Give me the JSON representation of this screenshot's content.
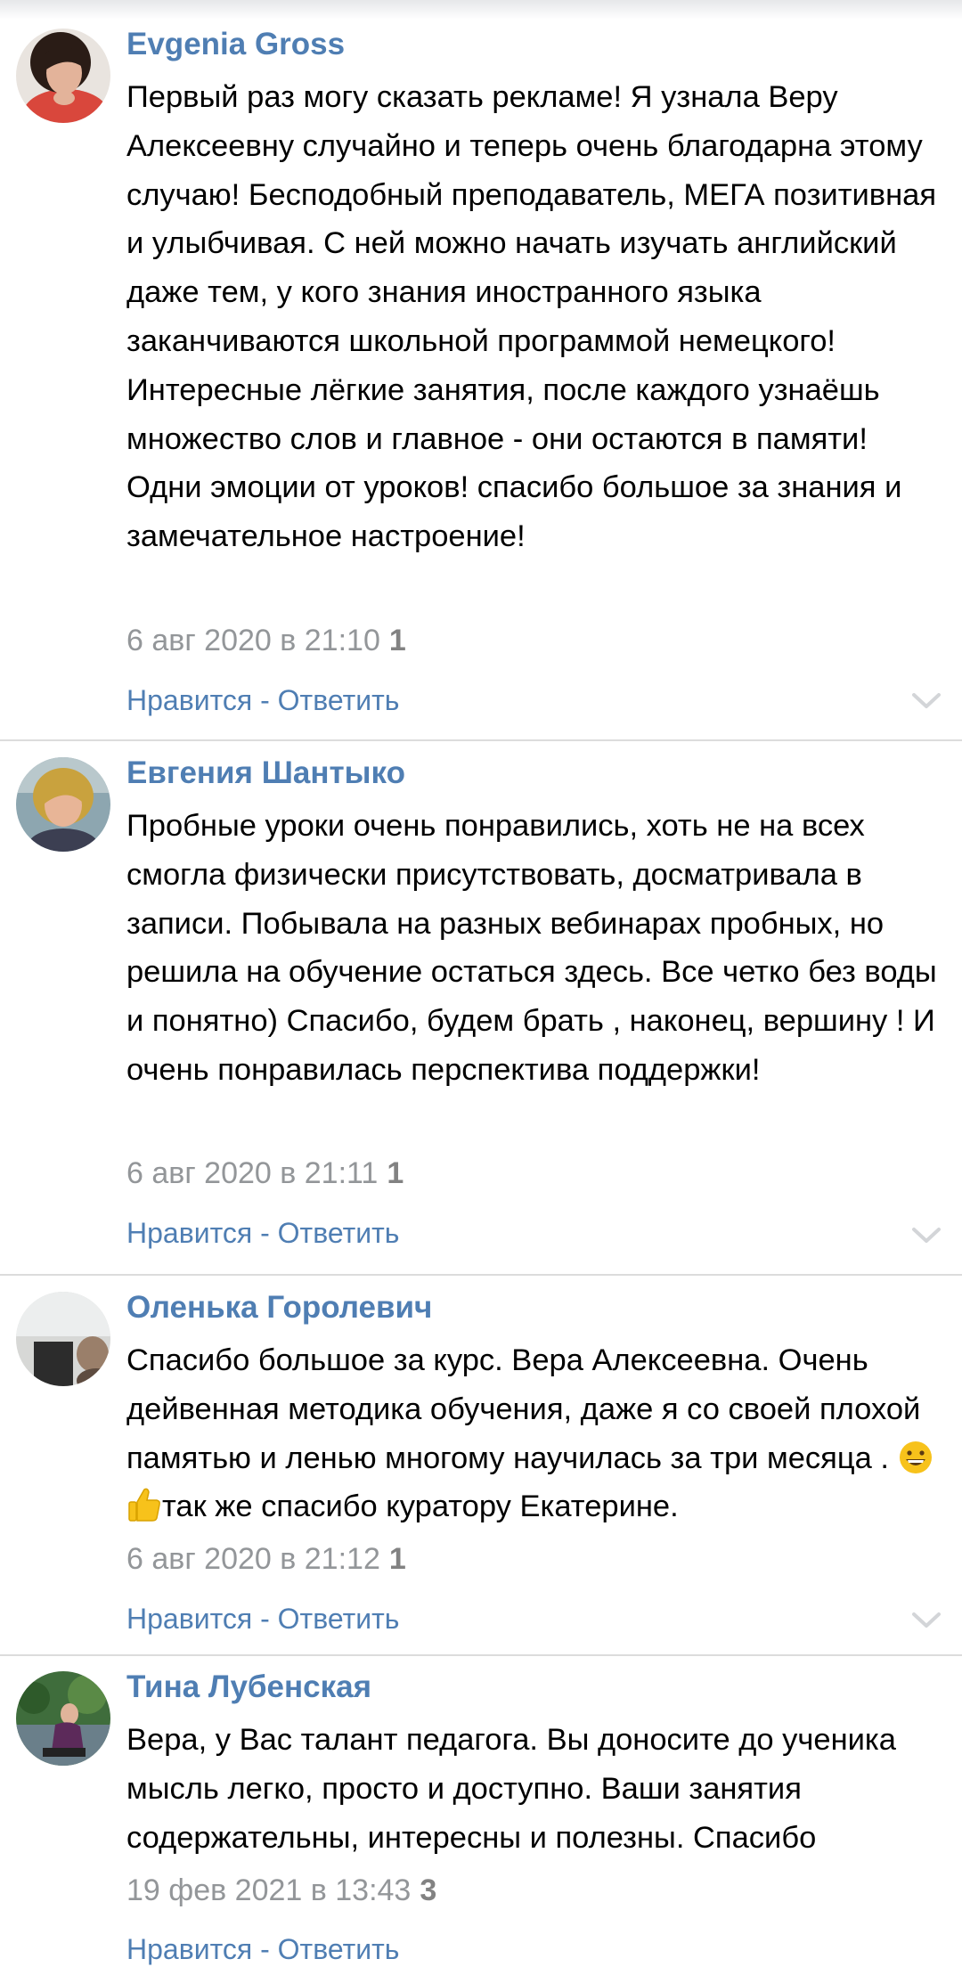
{
  "comments": [
    {
      "author": "Evgenia Gross",
      "paragraphs": [
        "Первый раз могу сказать рекламе! Я узнала Веру Алексеевну случайно и теперь очень благодарна этому случаю! Бесподобный преподаватель, МЕГА позитивная и улыбчивая. С ней можно начать изучать английский даже тем, у кого знания иностранного языка заканчиваются школьной программой немецкого!",
        "Интересные лёгкие занятия, после каждого узнаёшь множество слов и главное - они остаются в памяти! Одни эмоции от уроков! спасибо большое за знания и замечательное настроение!"
      ],
      "date": "6 авг 2020 в 21:10",
      "likes": "1",
      "like_label": "Нравится",
      "separator": " - ",
      "reply_label": "Ответить"
    },
    {
      "author": "Евгения Шантыко",
      "paragraphs": [
        "Пробные уроки очень понравились, хоть не на всех смогла физически присутствовать, досматривала в записи. Побывала на разных вебинарах пробных, но решила на обучение остаться здесь. Все четко без воды и понятно) Спасибо, будем брать , наконец, вершину ! И очень понравилась перспектива поддержки!"
      ],
      "date": "6 авг 2020 в 21:11",
      "likes": "1",
      "like_label": "Нравится",
      "separator": " - ",
      "reply_label": "Ответить"
    },
    {
      "author": "Оленька Горолевич",
      "text_before_emoji": "Спасибо большое за курс. Вера Алексеевна. Очень дейвенная методика обучения, даже я со своей плохой памятью и ленью многому научилась за три месяца . ",
      "text_after_emoji": "так же спасибо куратору Екатерине.",
      "emoji": [
        "grinning-face-emoji",
        "thumbs-up-emoji"
      ],
      "date": "6 авг 2020 в 21:12",
      "likes": "1",
      "like_label": "Нравится",
      "separator": " - ",
      "reply_label": "Ответить"
    },
    {
      "author": "Тина Лубенская",
      "paragraphs": [
        "Вера, у Вас талант педагога. Вы доносите до ученика мысль легко, просто и доступно. Ваши занятия содержательны, интересны и полезны. Спасибо"
      ],
      "date": "19 фев 2021 в 13:43",
      "likes": "3",
      "like_label": "Нравится",
      "separator": " - ",
      "reply_label": "Ответить"
    }
  ],
  "colors": {
    "link": "#4f7eb3",
    "meta": "#939699",
    "divider": "#dcdcdc",
    "text": "#000000"
  },
  "icons": {
    "expand": "chevron-down-icon"
  }
}
